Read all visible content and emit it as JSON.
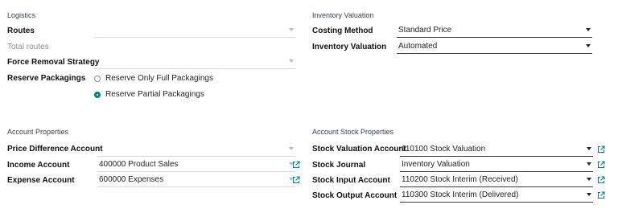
{
  "logistics": {
    "title": "Logistics",
    "routes_label": "Routes",
    "total_routes_label": "Total routes",
    "force_removal_label": "Force Removal Strategy",
    "reserve_packagings_label": "Reserve Packagings",
    "reserve_options": [
      "Reserve Only Full Packagings",
      "Reserve Partial Packagings"
    ],
    "reserve_selected": "Reserve Partial Packagings"
  },
  "inventory_valuation": {
    "title": "Inventory Valuation",
    "costing_method_label": "Costing Method",
    "costing_method_value": "Standard Price",
    "inventory_valuation_label": "Inventory Valuation",
    "inventory_valuation_value": "Automated"
  },
  "account_properties": {
    "title": "Account Properties",
    "price_difference_label": "Price Difference Account",
    "price_difference_value": "",
    "income_label": "Income Account",
    "income_value": "400000 Product Sales",
    "expense_label": "Expense Account",
    "expense_value": "600000 Expenses"
  },
  "account_stock_properties": {
    "title": "Account Stock Properties",
    "stock_valuation_label": "Stock Valuation Account",
    "stock_valuation_value": "110100 Stock Valuation",
    "stock_journal_label": "Stock Journal",
    "stock_journal_value": "Inventory Valuation",
    "stock_input_label": "Stock Input Account",
    "stock_input_value": "110200 Stock Interim (Received)",
    "stock_output_label": "Stock Output Account",
    "stock_output_value": "110300 Stock Interim (Delivered)"
  },
  "icons": {
    "external_link": "external-link-icon",
    "dropdown": "caret-down-icon"
  },
  "colors": {
    "accent": "#017e84"
  }
}
